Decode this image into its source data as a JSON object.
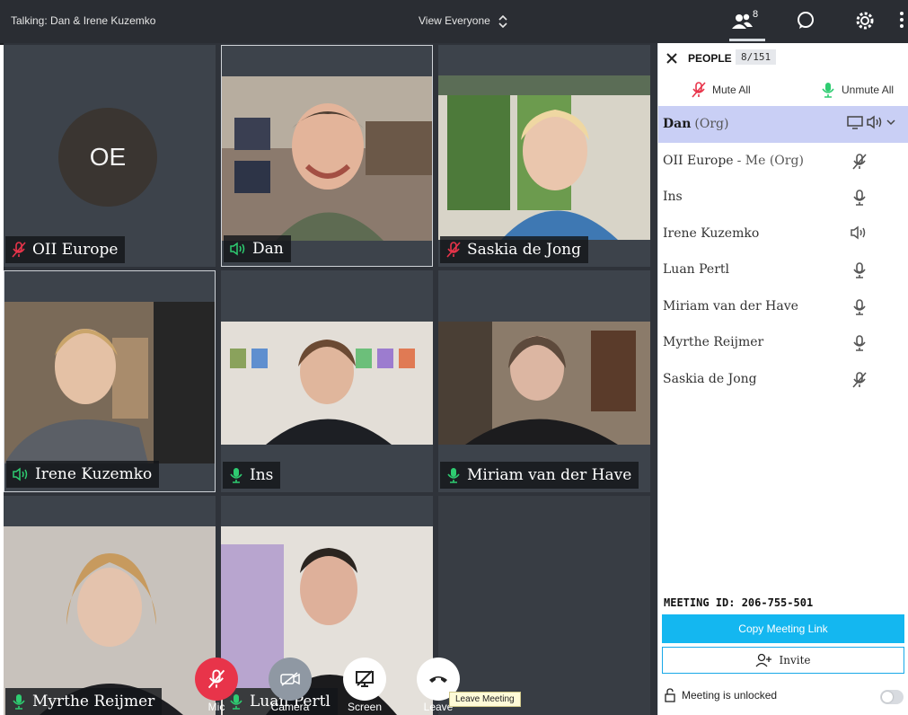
{
  "topbar": {
    "talking": "Talking: Dan & Irene Kuzemko",
    "view": "View Everyone",
    "people_count": "8"
  },
  "tiles": {
    "oe": {
      "initials": "OE",
      "name": "OII Europe"
    },
    "dan": {
      "name": "Dan"
    },
    "saskia": {
      "name": "Saskia de Jong"
    },
    "irene": {
      "name": "Irene Kuzemko"
    },
    "ins": {
      "name": "Ins"
    },
    "miriam": {
      "name": "Miriam van der Have"
    },
    "myrthe": {
      "name": "Myrthe Reijmer"
    },
    "luan": {
      "name": "Luan Pertl"
    }
  },
  "panel": {
    "title": "PEOPLE",
    "count": "8/151",
    "mute_all": "Mute All",
    "unmute_all": "Unmute All",
    "people": [
      {
        "name": "Dan",
        "role": "(Org)",
        "status": "screen-speaker"
      },
      {
        "name": "OII Europe",
        "role": "- Me (Org)",
        "status": "mic-muted"
      },
      {
        "name": "Ins",
        "role": "",
        "status": "mic"
      },
      {
        "name": "Irene Kuzemko",
        "role": "",
        "status": "speaker"
      },
      {
        "name": "Luan Pertl",
        "role": "",
        "status": "mic"
      },
      {
        "name": "Miriam van der Have",
        "role": "",
        "status": "mic"
      },
      {
        "name": "Myrthe Reijmer",
        "role": "",
        "status": "mic"
      },
      {
        "name": "Saskia de Jong",
        "role": "",
        "status": "mic-muted"
      }
    ],
    "meeting_id": "MEETING ID:  206-755-501",
    "copy_link": "Copy Meeting Link",
    "invite": "Invite",
    "unlocked": "Meeting is unlocked"
  },
  "controls": {
    "mic": "Mic",
    "camera": "Camera",
    "screen": "Screen",
    "leave": "Leave",
    "tooltip": "Leave Meeting"
  },
  "colors": {
    "accent": "#14b7f0",
    "muted_red": "#e8344a",
    "talking_green": "#2ecc71",
    "selected_row": "#c9cff5"
  }
}
